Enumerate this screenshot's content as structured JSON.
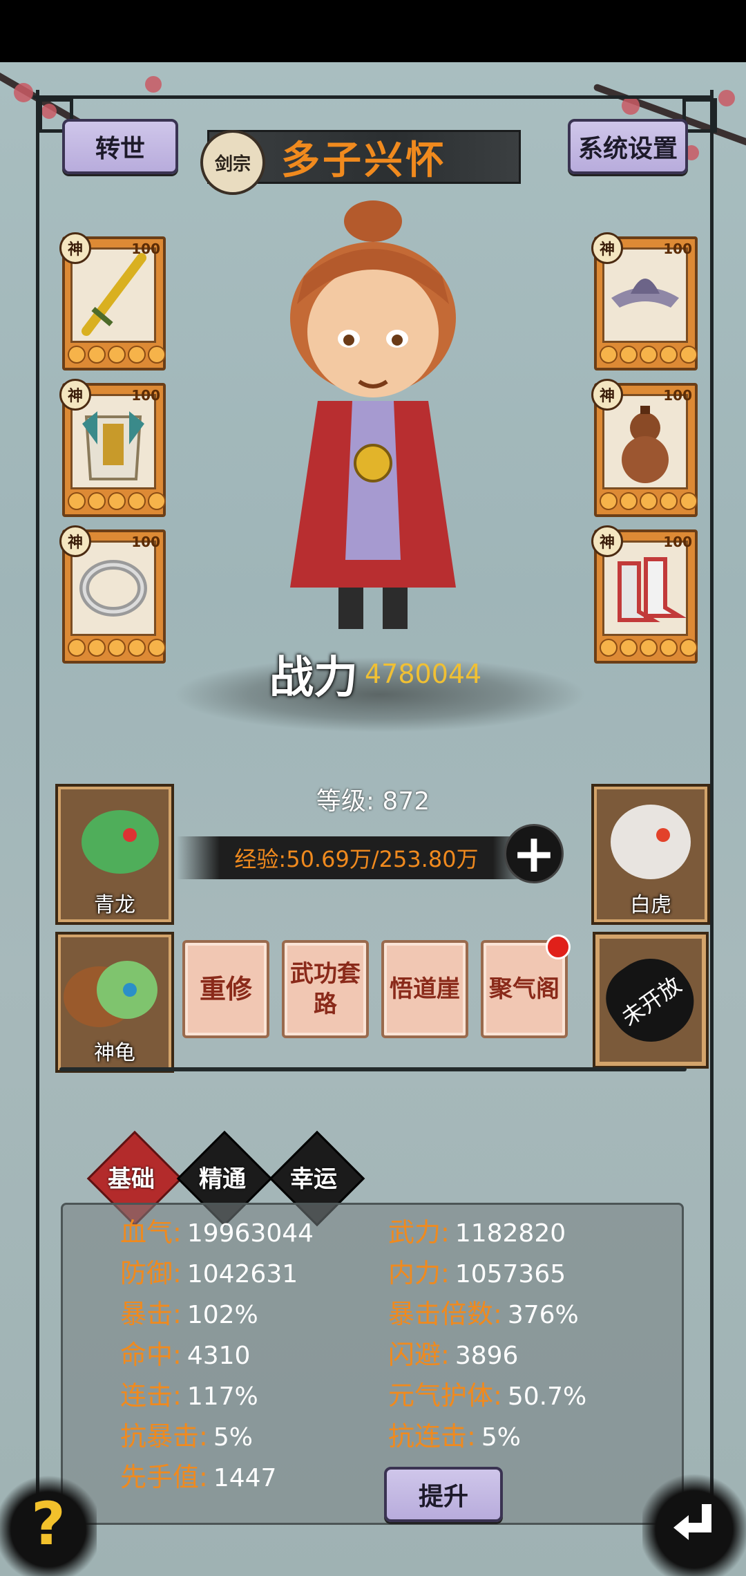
{
  "header": {
    "rebirth_label": "转世",
    "settings_label": "系统设置",
    "sect_badge": "剑宗",
    "character_name": "多子兴怀"
  },
  "equipment": {
    "tier_label": "神",
    "level": "100",
    "left": [
      {
        "icon": "golden-sword-icon"
      },
      {
        "icon": "armor-icon"
      },
      {
        "icon": "ring-icon"
      }
    ],
    "right": [
      {
        "icon": "hat-icon"
      },
      {
        "icon": "gourd-icon"
      },
      {
        "icon": "boots-icon"
      }
    ]
  },
  "hero": {
    "power_label": "战力",
    "power_value": "4780044",
    "level_text": "等级: 872",
    "exp_text": "经验:50.69万/253.80万"
  },
  "pets": [
    {
      "label": "青龙"
    },
    {
      "label": "白虎"
    },
    {
      "label": "神龟"
    }
  ],
  "skills": [
    {
      "label": "重修",
      "badge": false
    },
    {
      "label": "武功套路",
      "badge": false
    },
    {
      "label": "悟道崖",
      "badge": false
    },
    {
      "label": "聚气阁",
      "badge": true
    }
  ],
  "locked_slot": "未开放",
  "tabs": [
    "基础",
    "精通",
    "幸运"
  ],
  "stats_left": [
    {
      "key": "血气:",
      "value": "19963044"
    },
    {
      "key": "防御:",
      "value": "1042631"
    },
    {
      "key": "暴击:",
      "value": "102%"
    },
    {
      "key": "命中:",
      "value": "4310"
    },
    {
      "key": "连击:",
      "value": "117%"
    },
    {
      "key": "抗暴击:",
      "value": "5%"
    },
    {
      "key": "先手值:",
      "value": "1447"
    }
  ],
  "stats_right": [
    {
      "key": "武力:",
      "value": "1182820"
    },
    {
      "key": "内力:",
      "value": "1057365"
    },
    {
      "key": "暴击倍数:",
      "value": "376%"
    },
    {
      "key": "闪避:",
      "value": "3896"
    },
    {
      "key": "元气护体:",
      "value": "50.7%"
    },
    {
      "key": "抗连击:",
      "value": "5%"
    }
  ],
  "upgrade_label": "提升",
  "help_glyph": "?",
  "colors": {
    "accent_orange": "#f08a1e",
    "button_purple": "#c4b8e4",
    "active_tab": "#b32b2b"
  }
}
